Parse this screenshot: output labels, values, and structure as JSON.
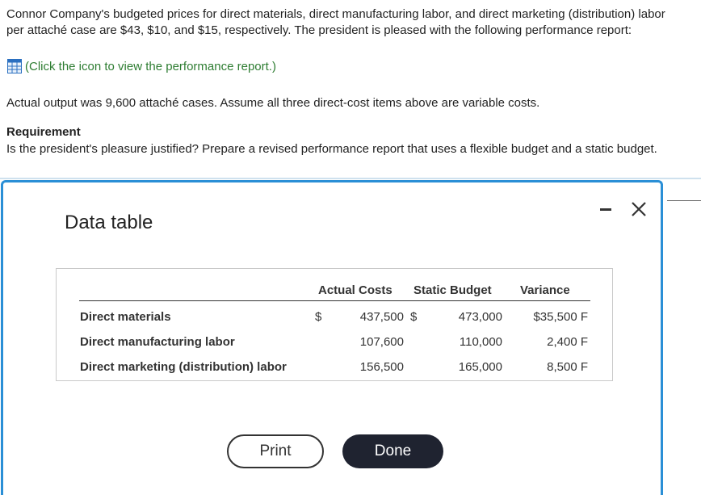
{
  "problem": {
    "intro": "Connor Company's budgeted prices for direct materials, direct manufacturing labor, and direct marketing (distribution) labor per attaché case are $43, $10, and $15, respectively. The president is pleased with the following performance report:",
    "link_text": "(Click the icon to view the performance report.)",
    "actual_output": "Actual output was 9,600 attaché cases. Assume all three direct-cost items above are variable costs.",
    "requirement_title": "Requirement",
    "requirement_text": "Is the president's pleasure justified? Prepare a revised performance report that uses a flexible budget and a static budget."
  },
  "modal": {
    "title": "Data table",
    "table": {
      "headers": [
        "Actual Costs",
        "Static Budget",
        "Variance"
      ],
      "dollar_sign_actual": "$",
      "dollar_sign_static": "$",
      "rows": [
        {
          "label": "Direct materials",
          "actual": "437,500",
          "static": "473,000",
          "variance": "$35,500 F"
        },
        {
          "label": "Direct manufacturing labor",
          "actual": "107,600",
          "static": "110,000",
          "variance": "2,400 F"
        },
        {
          "label": "Direct marketing (distribution) labor",
          "actual": "156,500",
          "static": "165,000",
          "variance": "8,500 F"
        }
      ]
    },
    "buttons": {
      "print": "Print",
      "done": "Done"
    }
  },
  "colors": {
    "link": "#2e7d32",
    "modal_border": "#2a8fd6",
    "done_bg": "#1f2330"
  },
  "icons": {
    "report_icon": "grid-table-icon",
    "minimize": "minimize-icon",
    "close": "close-icon"
  }
}
